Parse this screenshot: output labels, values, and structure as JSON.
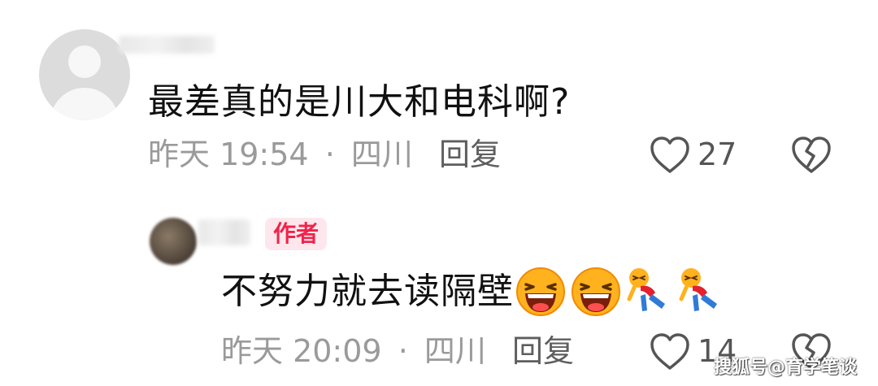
{
  "comment_1": {
    "text": "最差真的是川大和电科啊?",
    "time": "昨天 19:54",
    "separator": "·",
    "location": "四川",
    "reply_label": "回复",
    "like_count": "27"
  },
  "comment_2": {
    "badge_label": "作者",
    "text": "不努力就去读隔壁",
    "emojis": [
      "laughing-tears-emoji",
      "laughing-tears-emoji",
      "rolling-on-floor-emoji",
      "rolling-on-floor-emoji"
    ],
    "time": "昨天 20:09",
    "separator": "·",
    "location": "四川",
    "reply_label": "回复",
    "like_count": "14"
  },
  "watermark": "搜狐号@育学笔谈",
  "colors": {
    "badge_text": "#f2234b",
    "badge_bg": "#fde7ec",
    "meta_text": "#9a9a9a",
    "body_text": "#111111"
  }
}
